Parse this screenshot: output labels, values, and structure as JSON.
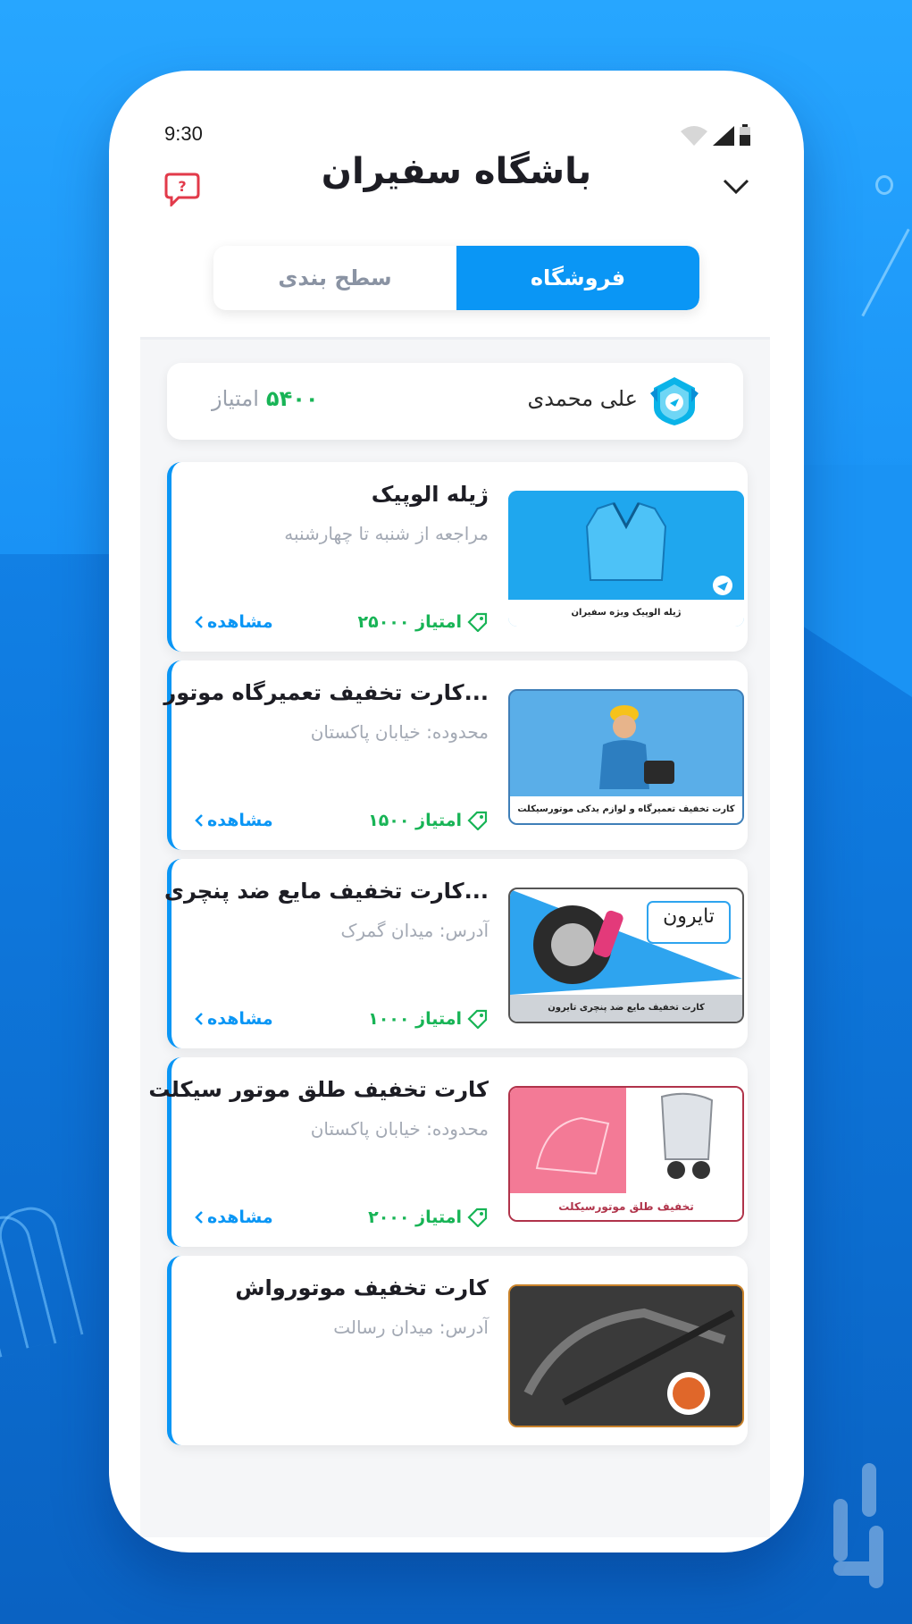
{
  "status_bar": {
    "time": "9:30"
  },
  "header": {
    "title": "باشگاه سفیران"
  },
  "tabs": [
    {
      "label": "فروشگاه",
      "active": true
    },
    {
      "label": "سطح بندی",
      "active": false
    }
  ],
  "user": {
    "name": "علی محمدی",
    "points_value": "۵۴۰۰",
    "points_label": "امتیاز"
  },
  "cards": [
    {
      "title": "ژیله الوپیک",
      "subtitle": "مراجعه از شنبه تا چهارشنبه",
      "cost": "۲۵۰۰۰ امتیاز",
      "action": "مشاهده",
      "image_caption": "ژیله الوپیک ویژه سفیران"
    },
    {
      "title": "کارت تخفیف تعمیرگاه موتور...",
      "subtitle": "محدوده: خیابان پاکستان",
      "cost": "۱۵۰۰ امتیاز",
      "action": "مشاهده",
      "image_caption": "کارت تخفیف تعمیرگاه و لوازم یدکی موتورسیکلت"
    },
    {
      "title": "کارت تخفیف مایع ضد پنچری...",
      "subtitle": "آدرس: میدان گمرک",
      "cost": "۱۰۰۰ امتیاز",
      "action": "مشاهده",
      "image_caption": "کارت تخفیف مایع ضد پنچری تایرون",
      "image_brand": "تایرون"
    },
    {
      "title": "کارت تخفیف طلق موتور سیکلت",
      "subtitle": "محدوده: خیابان پاکستان",
      "cost": "۲۰۰۰ امتیاز",
      "action": "مشاهده",
      "image_caption": "تخفیف طلق موتورسیکلت"
    },
    {
      "title": "کارت تخفیف موتورواش",
      "subtitle": "آدرس: میدان رسالت",
      "cost": "",
      "action": "",
      "image_caption": ""
    }
  ],
  "colors": {
    "accent": "#0a96f5",
    "points_green": "#18b456",
    "bg_blue": "#1a8ff2"
  }
}
